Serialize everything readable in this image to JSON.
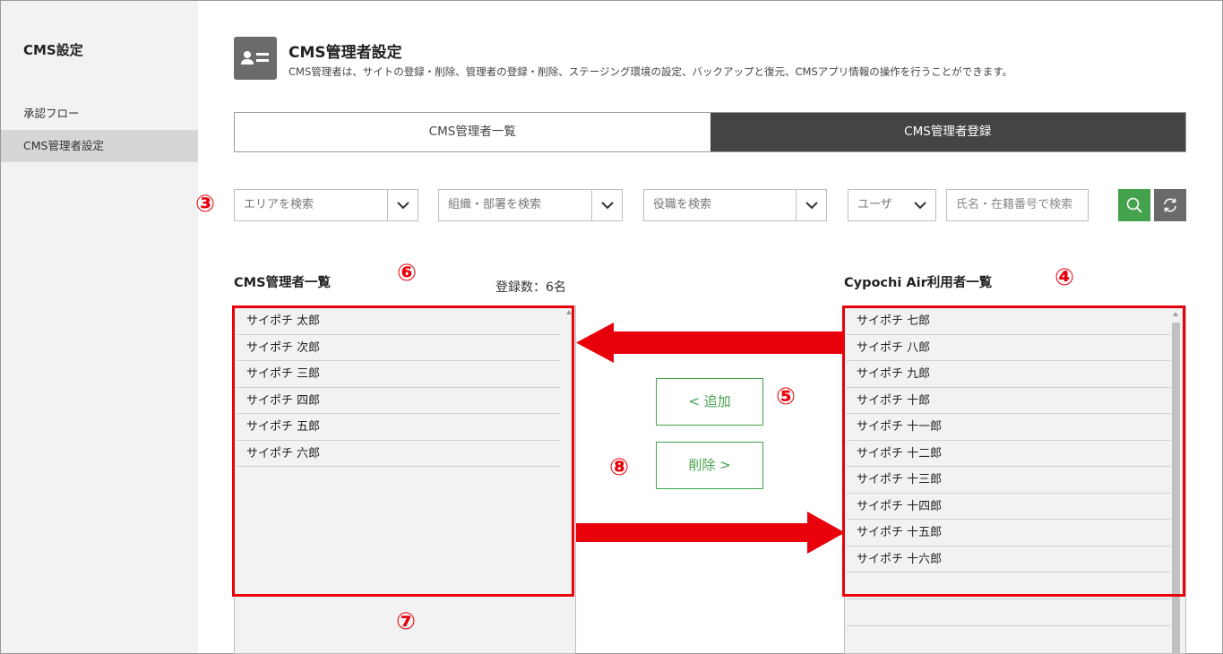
{
  "sidebar": {
    "title": "CMS設定",
    "items": [
      {
        "label": "承認フロー",
        "active": false
      },
      {
        "label": "CMS管理者設定",
        "active": true
      }
    ]
  },
  "header": {
    "icon": "user-card-icon",
    "title": "CMS管理者設定",
    "description": "CMS管理者は、サイトの登録・削除、管理者の登録・削除、ステージング環境の設定、バックアップと復元、CMSアプリ情報の操作を行うことができます。"
  },
  "tabs": [
    {
      "label": "CMS管理者一覧",
      "active": false
    },
    {
      "label": "CMS管理者登録",
      "active": true
    }
  ],
  "filters": {
    "area_placeholder": "エリアを検索",
    "org_placeholder": "組織・部署を検索",
    "role_placeholder": "役職を検索",
    "type_value": "ユーザ",
    "name_placeholder": "氏名・在籍番号で検索",
    "search_icon": "search-icon",
    "reset_icon": "refresh-icon"
  },
  "annotations": {
    "n3": "③",
    "n4": "④",
    "n5": "⑤",
    "n6": "⑥",
    "n7": "⑦",
    "n8": "⑧"
  },
  "admin_list": {
    "label": "CMS管理者一覧",
    "count_text": "登録数：6名",
    "items": [
      "サイポチ 太郎",
      "サイポチ 次郎",
      "サイポチ 三郎",
      "サイポチ 四郎",
      "サイポチ 五郎",
      "サイポチ 六郎"
    ]
  },
  "user_list": {
    "label": "Cypochi Air利用者一覧",
    "items": [
      "サイポチ 七郎",
      "サイポチ 八郎",
      "サイポチ 九郎",
      "サイポチ 十郎",
      "サイポチ 十一郎",
      "サイポチ 十二郎",
      "サイポチ 十三郎",
      "サイポチ 十四郎",
      "サイポチ 十五郎",
      "サイポチ 十六郎"
    ]
  },
  "actions": {
    "add_label": "< 追加",
    "remove_label": "削除 >"
  },
  "colors": {
    "accent_green": "#44a24d",
    "annotation_red": "#e8000b",
    "active_tab": "#444444"
  }
}
